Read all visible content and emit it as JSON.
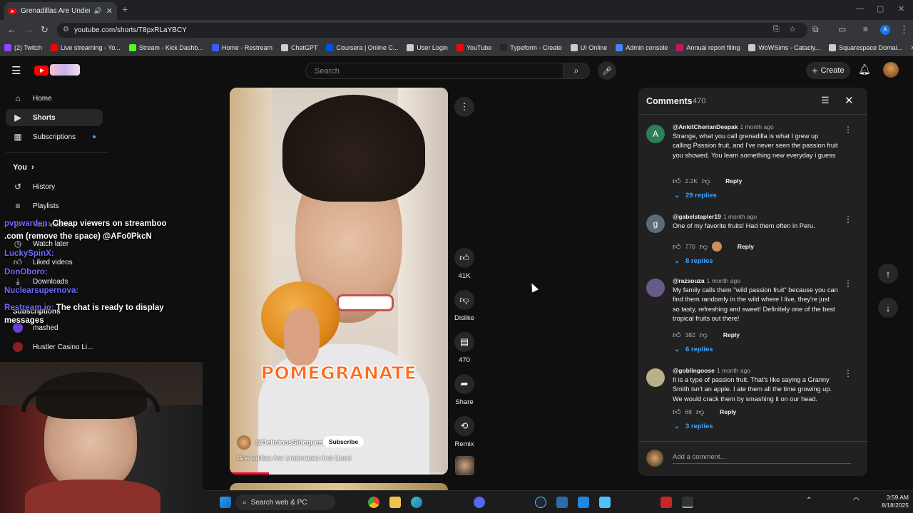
{
  "browser": {
    "tab_title": "Grenadillas Are Underrated",
    "new_tab": "+",
    "url": "youtube.com/shorts/T8pxRLaYBCY",
    "bookmarks": [
      {
        "label": "(2) Twitch",
        "color": "#9146ff"
      },
      {
        "label": "Live streaming - Yo...",
        "color": "#ff0000"
      },
      {
        "label": "Stream - Kick Dashb...",
        "color": "#53fc18"
      },
      {
        "label": "Home - Restream",
        "color": "#3d5afe"
      },
      {
        "label": "ChatGPT",
        "color": "#cccccc"
      },
      {
        "label": "Coursera | Online C...",
        "color": "#0056d2"
      },
      {
        "label": "User Login",
        "color": "#cccccc"
      },
      {
        "label": "YouTube",
        "color": "#ff0000"
      },
      {
        "label": "Typeform - Create",
        "color": "#262627"
      },
      {
        "label": "UI Online",
        "color": "#cccccc"
      },
      {
        "label": "Admin console",
        "color": "#4285f4"
      },
      {
        "label": "Annual report filing",
        "color": "#c2185b"
      },
      {
        "label": "WoWSims - Catacly...",
        "color": "#cccccc"
      },
      {
        "label": "Squarespace Domai...",
        "color": "#cccccc"
      }
    ],
    "profile_initial": "A"
  },
  "youtube": {
    "search_placeholder": "Search",
    "create_label": "Create",
    "sidebar": [
      {
        "label": "Home",
        "icon": "home-icon"
      },
      {
        "label": "Shorts",
        "icon": "shorts-icon"
      },
      {
        "label": "Subscriptions",
        "icon": "subscriptions-icon"
      },
      {
        "label": "You",
        "icon": "chevron-right-icon"
      },
      {
        "label": "History",
        "icon": "history-icon"
      },
      {
        "label": "Playlists",
        "icon": "playlists-icon"
      },
      {
        "label": "Your videos",
        "icon": "your-videos-icon"
      },
      {
        "label": "Watch later",
        "icon": "watch-later-icon"
      },
      {
        "label": "Liked videos",
        "icon": "liked-videos-icon"
      },
      {
        "label": "Downloads",
        "icon": "downloads-icon"
      },
      {
        "label": "Subscriptions",
        "icon": ""
      },
      {
        "label": "mashed",
        "icon": "channel-avatar"
      },
      {
        "label": "Hustler Casino Li...",
        "icon": "channel-avatar"
      }
    ]
  },
  "chat_overlay": [
    {
      "user": "pvpwarden:",
      "message": "Cheap viewers on streamboo"
    },
    {
      "user": "",
      "message": ".com (remove the space) @AFo0PkcN"
    },
    {
      "user": "LuckySpinX:",
      "message": ""
    },
    {
      "user": "DonOboro:",
      "message": ""
    },
    {
      "user": "Nuclearsupernova:",
      "message": ""
    },
    {
      "user": "Restream.io:",
      "message": "The chat is ready to display"
    },
    {
      "user": "",
      "message": "messages"
    }
  ],
  "short": {
    "caption": "POMEGRANATE",
    "channel": "@DeliciousSidequest",
    "subscribe_label": "Subscribe",
    "title": "Grenadillas Are Underrated And Good",
    "progress_fraction": 0.18,
    "actions": {
      "likes": "41K",
      "dislike": "Dislike",
      "comments": "470",
      "share": "Share",
      "remix": "Remix"
    }
  },
  "comments_panel": {
    "title": "Comments",
    "count": "470",
    "add_placeholder": "Add a comment...",
    "items": [
      {
        "author": "@AnkitCherianDeepak",
        "time": "1 month ago",
        "avatar_letter": "A",
        "avatar_color": "#2e7d5b",
        "text": "Strange, what you call grenadilla is what I grew up calling Passion fruit, and I've never seen the passion fruit you showed. You learn something new everyday i guess",
        "likes": "2.2K",
        "reply_label": "Reply",
        "replies": "29 replies"
      },
      {
        "author": "@gabelstapler19",
        "time": "1 month ago",
        "avatar_letter": "g",
        "avatar_color": "#5f6b73",
        "text": "One of my favorite fruits! Had them often in Peru.",
        "likes": "770",
        "reply_label": "Reply",
        "replies": "8 replies"
      },
      {
        "author": "@razsouza",
        "time": "1 month ago",
        "avatar_letter": "",
        "avatar_color": "#6a5a8c",
        "text": "My family calls them \"wild passion fruit\" because you can find them randomly in the wild where I live, they're just so tasty, refreshing and sweet! Definitely one of the best tropical fruits out there!",
        "likes": "382",
        "reply_label": "Reply",
        "replies": "6 replies"
      },
      {
        "author": "@goblingoose",
        "time": "1 month ago",
        "avatar_letter": "",
        "avatar_color": "#b9b08a",
        "text": "It is a type of passion fruit. That's like saying a Granny Smith isn't an apple. I ate them all the time growing up. We would crack them by smashing it on our head.",
        "likes": "68",
        "reply_label": "Reply",
        "replies": "3 replies"
      }
    ]
  },
  "taskbar": {
    "search_label": "Search web & PC",
    "time": "3:59 AM",
    "date": "8/18/2025"
  }
}
